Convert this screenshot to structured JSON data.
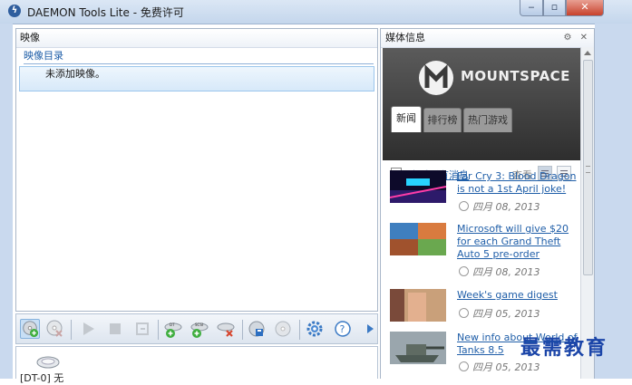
{
  "window": {
    "title": "DAEMON Tools Lite - 免费许可",
    "minimize_glyph": "‒",
    "maximize_glyph": "▫",
    "close_glyph": "✕"
  },
  "images_panel": {
    "header": "映像",
    "group_label": "映像目录",
    "empty_item": "未添加映像。"
  },
  "drive": {
    "label": "[DT-0] 无"
  },
  "media_panel": {
    "header": "媒体信息",
    "header_icons": "⚙ ✕",
    "logo_text": "MOUNTSPACE",
    "tabs": [
      "新闻",
      "排行榜",
      "热门游戏"
    ],
    "see_all": "查看所有消息",
    "view_label": "查看",
    "news": [
      {
        "title": "Far Cry 3: Blood Dragon is not a 1st April joke!",
        "date": "四月 08, 2013"
      },
      {
        "title": "Microsoft  will give $20 for each  Grand Theft Auto 5 pre-order",
        "date": "四月 08, 2013"
      },
      {
        "title": "Week's game digest",
        "date": "四月 05, 2013"
      },
      {
        "title": "New info about World of Tanks 8.5",
        "date": "四月 05, 2013"
      }
    ]
  },
  "watermark": "最需教育",
  "colors": {
    "accent": "#1f5ea8",
    "selection": "#d7e9f9",
    "banner": "#3c3c3c"
  }
}
